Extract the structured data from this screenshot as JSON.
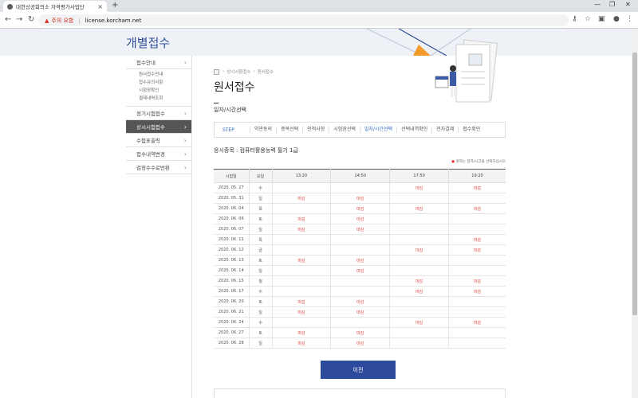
{
  "browser": {
    "tab_title": "대한상공회의소 자격평가사업단",
    "url_warning": "주의 요함",
    "url": "license.korcham.net"
  },
  "banner": {
    "title": "개별접수"
  },
  "sidebar": {
    "items": [
      {
        "label": "접수안내"
      },
      {
        "label": "정기시험접수"
      },
      {
        "label": "상시시험접수"
      },
      {
        "label": "수험표출력"
      },
      {
        "label": "접수내역변경"
      },
      {
        "label": "검정수수료반환"
      }
    ],
    "sub_items": [
      "원서접수안내",
      "접수유의사항",
      "시험장확인",
      "결제내역조회"
    ]
  },
  "breadcrumb": [
    "상시시험접수",
    "원서접수"
  ],
  "page": {
    "title": "원서접수",
    "subtitle": "일자/시간선택",
    "exam_label": "응시종목 : 컴퓨터활용능력 필기 1급",
    "note": "원하는 일자/시간을 선택하십시오"
  },
  "steps": {
    "label": "STEP",
    "items": [
      "약관동의",
      "종목선택",
      "인적사항",
      "시험장선택",
      "일자/시간선택",
      "선택내역확인",
      "전자결제",
      "접수확인"
    ],
    "current": 4
  },
  "table": {
    "headers": [
      "시험일",
      "요일",
      "13:20",
      "14:50",
      "17:50",
      "19:20"
    ],
    "rows": [
      [
        "2020. 05. 27",
        "수",
        "",
        "",
        "마감",
        "마감"
      ],
      [
        "2020. 05. 31",
        "일",
        "마감",
        "마감",
        "",
        ""
      ],
      [
        "2020. 06. 04",
        "목",
        "",
        "마감",
        "마감",
        "마감"
      ],
      [
        "2020. 06. 06",
        "토",
        "마감",
        "마감",
        "",
        ""
      ],
      [
        "2020. 06. 07",
        "일",
        "마감",
        "마감",
        "",
        ""
      ],
      [
        "2020. 06. 11",
        "목",
        "",
        "",
        "",
        "마감"
      ],
      [
        "2020. 06. 12",
        "금",
        "",
        "",
        "마감",
        "마감"
      ],
      [
        "2020. 06. 13",
        "토",
        "마감",
        "마감",
        "",
        ""
      ],
      [
        "2020. 06. 14",
        "일",
        "",
        "마감",
        "",
        ""
      ],
      [
        "2020. 06. 15",
        "월",
        "",
        "",
        "마감",
        "마감"
      ],
      [
        "2020. 06. 17",
        "수",
        "",
        "",
        "마감",
        "마감"
      ],
      [
        "2020. 06. 20",
        "토",
        "마감",
        "마감",
        "",
        ""
      ],
      [
        "2020. 06. 21",
        "일",
        "마감",
        "마감",
        "",
        ""
      ],
      [
        "2020. 06. 24",
        "수",
        "",
        "",
        "마감",
        "마감"
      ],
      [
        "2020. 06. 27",
        "토",
        "마감",
        "마감",
        "",
        ""
      ],
      [
        "2020. 06. 28",
        "일",
        "마감",
        "마감",
        "",
        ""
      ]
    ]
  },
  "buttons": {
    "prev": "이전"
  },
  "icons": {
    "back": "arrow-left-icon",
    "forward": "arrow-right-icon",
    "reload": "reload-icon",
    "key": "key-icon",
    "star": "star-icon",
    "profile": "profile-icon",
    "menu": "menu-icon"
  }
}
